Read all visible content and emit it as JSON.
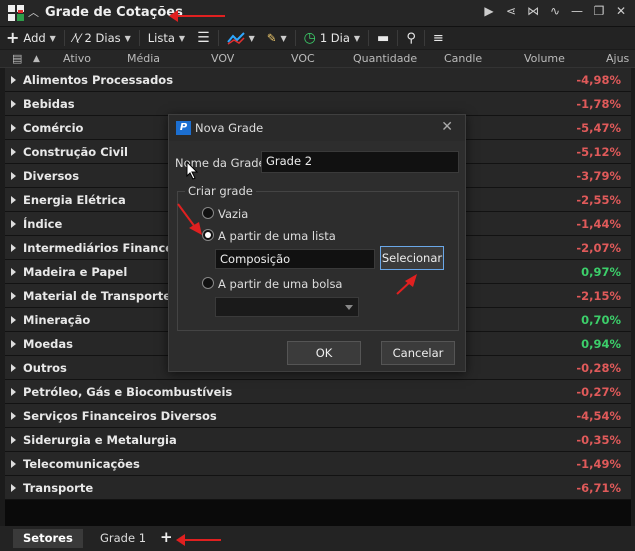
{
  "window": {
    "title": "Grade de Cotações"
  },
  "toolbar": {
    "add": "Add",
    "period": "2 Dias",
    "list": "Lista",
    "interval": "1 Dia"
  },
  "columns": [
    "Ativo",
    "Média",
    "VOV",
    "VOC",
    "Quantidade",
    "Candle",
    "Volume",
    "Ajus"
  ],
  "sectors": [
    {
      "name": "Alimentos Processados",
      "value": "-4,98%",
      "trend": "neg"
    },
    {
      "name": "Bebidas",
      "value": "-1,78%",
      "trend": "neg"
    },
    {
      "name": "Comércio",
      "value": "-5,47%",
      "trend": "neg"
    },
    {
      "name": "Construção Civil",
      "value": "-5,12%",
      "trend": "neg"
    },
    {
      "name": "Diversos",
      "value": "-3,79%",
      "trend": "neg"
    },
    {
      "name": "Energia Elétrica",
      "value": "-2,55%",
      "trend": "neg"
    },
    {
      "name": "Índice",
      "value": "-1,44%",
      "trend": "neg"
    },
    {
      "name": "Intermediários Financeiros",
      "value": "-2,07%",
      "trend": "neg"
    },
    {
      "name": "Madeira e Papel",
      "value": "0,97%",
      "trend": "pos"
    },
    {
      "name": "Material de Transporte",
      "value": "-2,15%",
      "trend": "neg"
    },
    {
      "name": "Mineração",
      "value": "0,70%",
      "trend": "pos"
    },
    {
      "name": "Moedas",
      "value": "0,94%",
      "trend": "pos"
    },
    {
      "name": "Outros",
      "value": "-0,28%",
      "trend": "neg"
    },
    {
      "name": "Petróleo, Gás e Biocombustíveis",
      "value": "-0,27%",
      "trend": "neg"
    },
    {
      "name": "Serviços Financeiros Diversos",
      "value": "-4,54%",
      "trend": "neg"
    },
    {
      "name": "Siderurgia e Metalurgia",
      "value": "-0,35%",
      "trend": "neg"
    },
    {
      "name": "Telecomunicações",
      "value": "-1,49%",
      "trend": "neg"
    },
    {
      "name": "Transporte",
      "value": "-6,71%",
      "trend": "neg"
    }
  ],
  "tabs": {
    "sectors": "Setores",
    "grade1": "Grade 1",
    "add": "+"
  },
  "dialog": {
    "title": "Nova Grade",
    "name_label": "Nome da Grade:",
    "name_value": "Grade 2",
    "group_label": "Criar grade",
    "option_empty": "Vazia",
    "option_list": "A partir de uma lista",
    "list_value": "Composição",
    "select_button": "Selecionar",
    "option_exchange": "A partir de uma bolsa",
    "ok": "OK",
    "cancel": "Cancelar",
    "close": "✕"
  },
  "colors": {
    "negative": "#e05a5a",
    "positive": "#3ccf6a",
    "annotation": "#e02020",
    "accent": "#1c6fd1"
  }
}
